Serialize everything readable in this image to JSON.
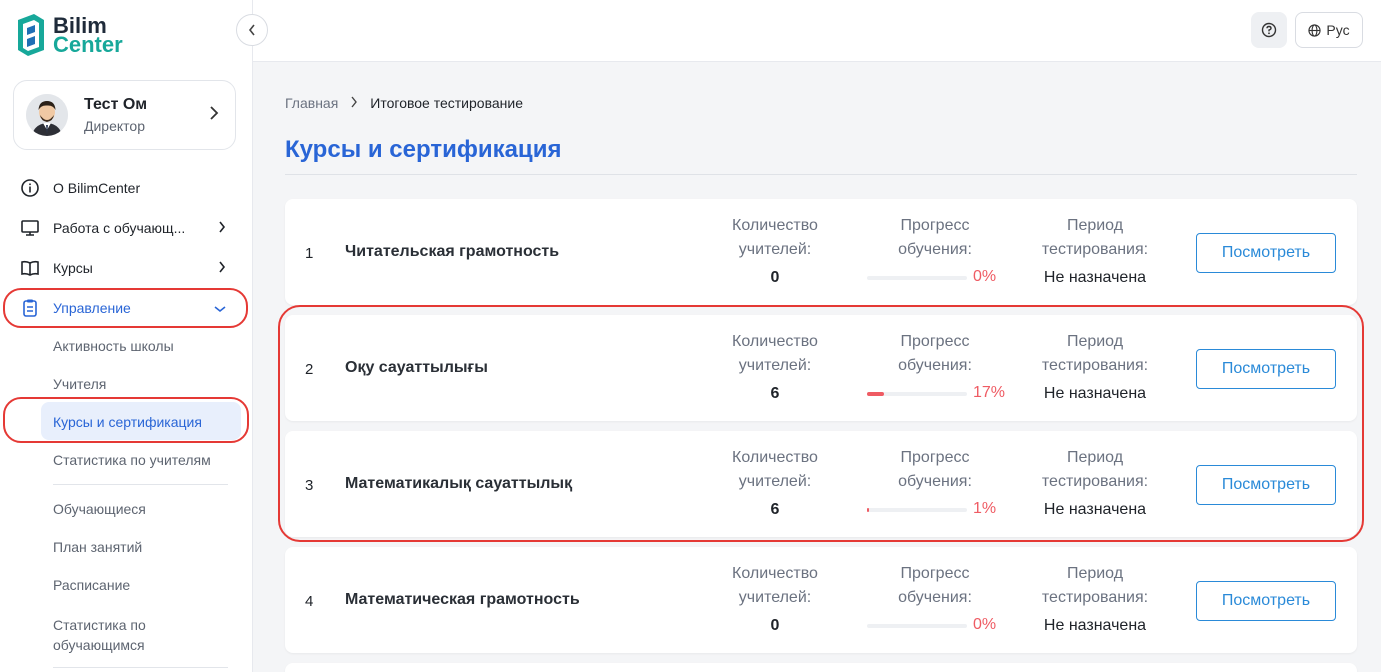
{
  "app": {
    "logo_line1": "Bilim",
    "logo_line2": "Center"
  },
  "user": {
    "name": "Тест Ом",
    "role": "Директор"
  },
  "nav": {
    "items": [
      {
        "label": "О BilimCenter",
        "icon": "info-icon"
      },
      {
        "label": "Работа с обучающ...",
        "icon": "monitor-icon"
      },
      {
        "label": "Курсы",
        "icon": "book-icon"
      },
      {
        "label": "Управление",
        "icon": "clipboard-icon"
      }
    ],
    "sub_items": [
      "Активность школы",
      "Учителя",
      "Курсы и сертификация",
      "Статистика по учителям",
      "Обучающиеся",
      "План занятий",
      "Расписание",
      "Статистика по",
      "обучающимся"
    ]
  },
  "topbar": {
    "lang": "Рус"
  },
  "breadcrumb": {
    "home": "Главная",
    "current": "Итоговое тестирование"
  },
  "page": {
    "title": "Курсы и сертификация"
  },
  "columns": {
    "teachers_line1": "Количество",
    "teachers_line2": "учителей:",
    "progress_line1": "Прогресс",
    "progress_line2": "обучения:",
    "period_line1": "Период",
    "period_line2": "тестирования:"
  },
  "view_label": "Посмотреть",
  "courses": [
    {
      "num": "1",
      "name": "Читательская грамотность",
      "teachers": "0",
      "progress_text": "0%",
      "progress": 0,
      "period": "Не назначена"
    },
    {
      "num": "2",
      "name": "Оқу сауаттылығы",
      "teachers": "6",
      "progress_text": "17%",
      "progress": 0.17,
      "period": "Не назначена"
    },
    {
      "num": "3",
      "name": "Математикалық сауаттылық",
      "teachers": "6",
      "progress_text": "1%",
      "progress": 0.01,
      "period": "Не назначена"
    },
    {
      "num": "4",
      "name": "Математическая грамотность",
      "teachers": "0",
      "progress_text": "0%",
      "progress": 0,
      "period": "Не назначена"
    }
  ],
  "colors": {
    "accent": "#2965d6",
    "progress": "#ef5b63",
    "highlight_ring": "#e53935",
    "button": "#2a8ad8"
  }
}
